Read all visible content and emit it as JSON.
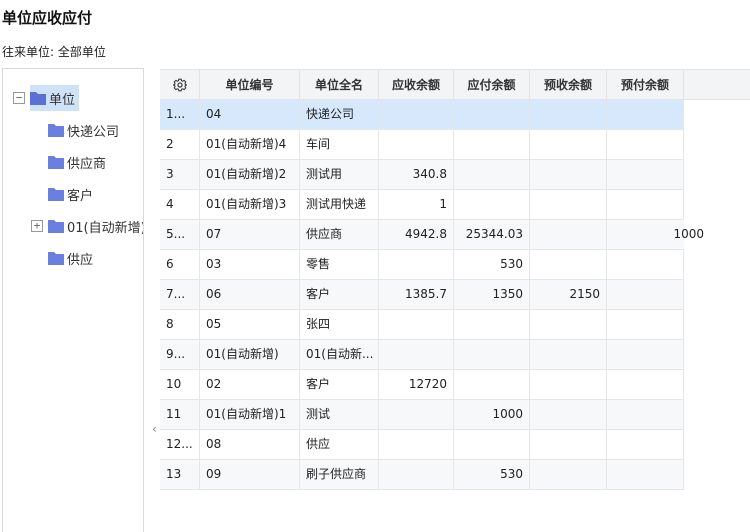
{
  "page": {
    "title": "单位应收应付",
    "filter": "往来单位: 全部单位"
  },
  "tree": {
    "root": "单位",
    "children": [
      "快递公司",
      "供应商",
      "客户",
      "01(自动新增)",
      "供应"
    ]
  },
  "table": {
    "columns": [
      "单位编号",
      "单位全名",
      "应收余额",
      "应付余额",
      "预收余额",
      "预付余额"
    ],
    "rows": [
      {
        "idx": "1...",
        "code": "04",
        "name": "快递公司",
        "receivable": "",
        "payable": "",
        "prereceived": "",
        "prepaid": ""
      },
      {
        "idx": "2",
        "code": "01(自动新增)4",
        "name": "车间",
        "receivable": "",
        "payable": "",
        "prereceived": "",
        "prepaid": ""
      },
      {
        "idx": "3",
        "code": "01(自动新增)2",
        "name": "测试用",
        "receivable": "340.8",
        "payable": "",
        "prereceived": "",
        "prepaid": ""
      },
      {
        "idx": "4",
        "code": "01(自动新增)3",
        "name": "测试用快递",
        "receivable": "1",
        "payable": "",
        "prereceived": "",
        "prepaid": ""
      },
      {
        "idx": "5...",
        "code": "07",
        "name": "供应商",
        "receivable": "4942.8",
        "payable": "25344.03",
        "prereceived": "",
        "prepaid": "1000"
      },
      {
        "idx": "6",
        "code": "03",
        "name": "零售",
        "receivable": "",
        "payable": "530",
        "prereceived": "",
        "prepaid": ""
      },
      {
        "idx": "7...",
        "code": "06",
        "name": "客户",
        "receivable": "1385.7",
        "payable": "1350",
        "prereceived": "2150",
        "prepaid": ""
      },
      {
        "idx": "8",
        "code": "05",
        "name": "张四",
        "receivable": "",
        "payable": "",
        "prereceived": "",
        "prepaid": ""
      },
      {
        "idx": "9...",
        "code": "01(自动新增)",
        "name": "01(自动新...",
        "receivable": "",
        "payable": "",
        "prereceived": "",
        "prepaid": ""
      },
      {
        "idx": "10",
        "code": "02",
        "name": "客户",
        "receivable": "12720",
        "payable": "",
        "prereceived": "",
        "prepaid": ""
      },
      {
        "idx": "11",
        "code": "01(自动新增)1",
        "name": "测试",
        "receivable": "",
        "payable": "1000",
        "prereceived": "",
        "prepaid": ""
      },
      {
        "idx": "12...",
        "code": "08",
        "name": "供应",
        "receivable": "",
        "payable": "",
        "prereceived": "",
        "prepaid": ""
      },
      {
        "idx": "13",
        "code": "09",
        "name": "刷子供应商",
        "receivable": "",
        "payable": "530",
        "prereceived": "",
        "prepaid": ""
      }
    ]
  },
  "icons": {
    "settings": "gear-icon",
    "folder": "folder-icon",
    "collapse": "chevron-left-icon"
  },
  "colors": {
    "folder": "#5b6fd6",
    "selected_row": "#d6e8fb",
    "selected_tree": "#cfe3f8"
  }
}
